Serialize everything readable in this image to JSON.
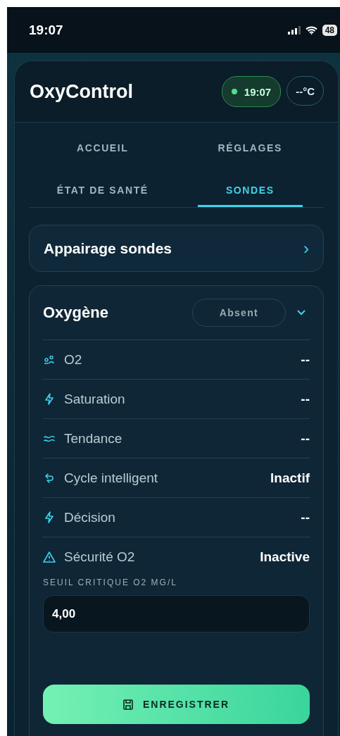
{
  "status_bar": {
    "time": "19:07",
    "battery": "48"
  },
  "header": {
    "title": "OxyControl",
    "clock": "19:07",
    "connected": true,
    "temperature": "--°C"
  },
  "tabs": [
    {
      "label": "ACCUEIL",
      "selected": false
    },
    {
      "label": "RÉGLAGES",
      "selected": false
    },
    {
      "label": "ÉTAT DE SANTÉ",
      "selected": false
    },
    {
      "label": "SONDES",
      "selected": true
    }
  ],
  "pairing": {
    "label": "Appairage sondes",
    "chevron": "›"
  },
  "probe": {
    "title": "Oxygène",
    "status": "Absent",
    "expanded": true,
    "rows": [
      {
        "kind": "people",
        "label": "O2",
        "value": "--"
      },
      {
        "kind": "bolt",
        "label": "Saturation",
        "value": "--"
      },
      {
        "kind": "wave",
        "label": "Tendance",
        "value": "--"
      },
      {
        "kind": "cycle",
        "label": "Cycle intelligent",
        "value": "Inactif"
      },
      {
        "kind": "bolt",
        "label": "Décision",
        "value": "--"
      },
      {
        "kind": "warning",
        "label": "Sécurité O2",
        "value": "Inactive"
      }
    ],
    "threshold": {
      "label": "SEUIL CRITIQUE O2 MG/L",
      "value": "4,00"
    },
    "save_button": "ENREGISTRER"
  }
}
